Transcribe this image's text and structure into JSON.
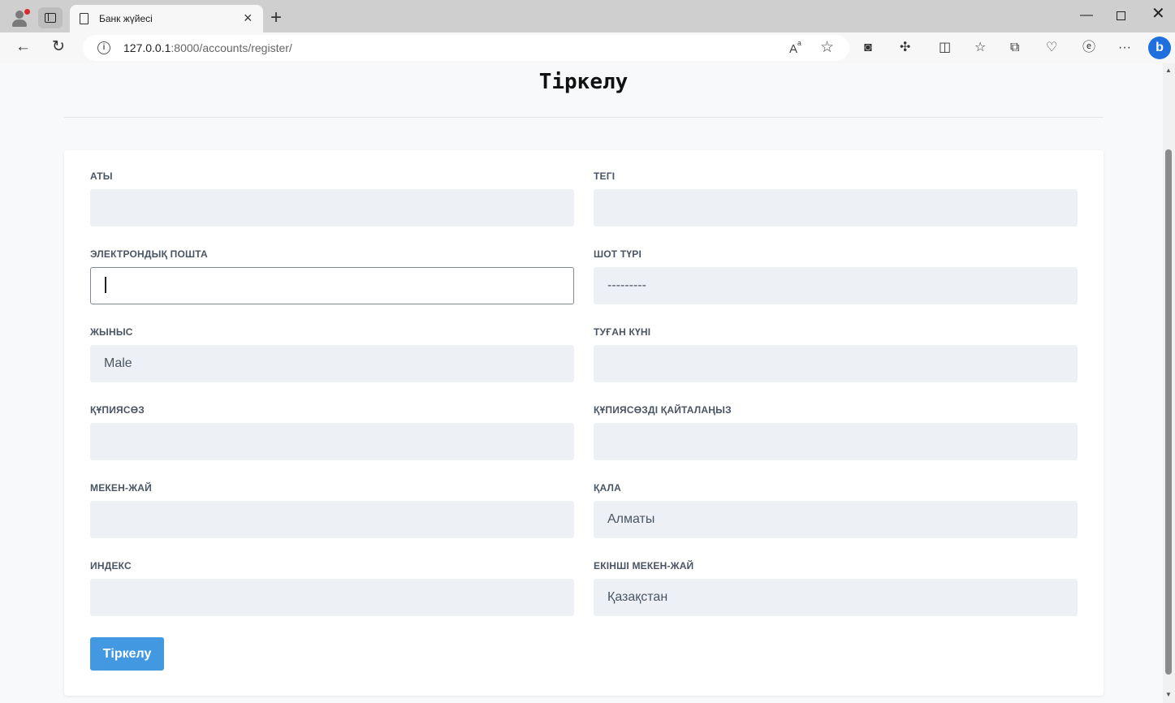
{
  "browser": {
    "tab_title": "Банк жүйесі",
    "url_host": "127.0.0.1",
    "url_path": ":8000/accounts/register/"
  },
  "page": {
    "heading": "Тіркелу",
    "fields": [
      {
        "label": "АТЫ",
        "value": ""
      },
      {
        "label": "ТЕГІ",
        "value": ""
      },
      {
        "label": "ЭЛЕКТРОНДЫҚ ПОШТА",
        "value": ""
      },
      {
        "label": "ШОТ ТҮРІ",
        "value": "---------"
      },
      {
        "label": "ЖЫНЫС",
        "value": "Male"
      },
      {
        "label": "ТУҒАН КҮНІ",
        "value": ""
      },
      {
        "label": "ҚҰПИЯСӨЗ",
        "value": ""
      },
      {
        "label": "ҚҰПИЯСӨЗДІ ҚАЙТАЛАҢЫЗ",
        "value": ""
      },
      {
        "label": "МЕКЕН-ЖАЙ",
        "value": ""
      },
      {
        "label": "ҚАЛА",
        "value": "Алматы"
      },
      {
        "label": "ИНДЕКС",
        "value": ""
      },
      {
        "label": "ЕКІНШІ МЕКЕН-ЖАЙ",
        "value": "Қазақстан"
      }
    ],
    "submit_label": "Тіркелу"
  },
  "colors": {
    "accent": "#4299e1",
    "input_bg": "#edf1f5",
    "label": "#4a5563"
  }
}
